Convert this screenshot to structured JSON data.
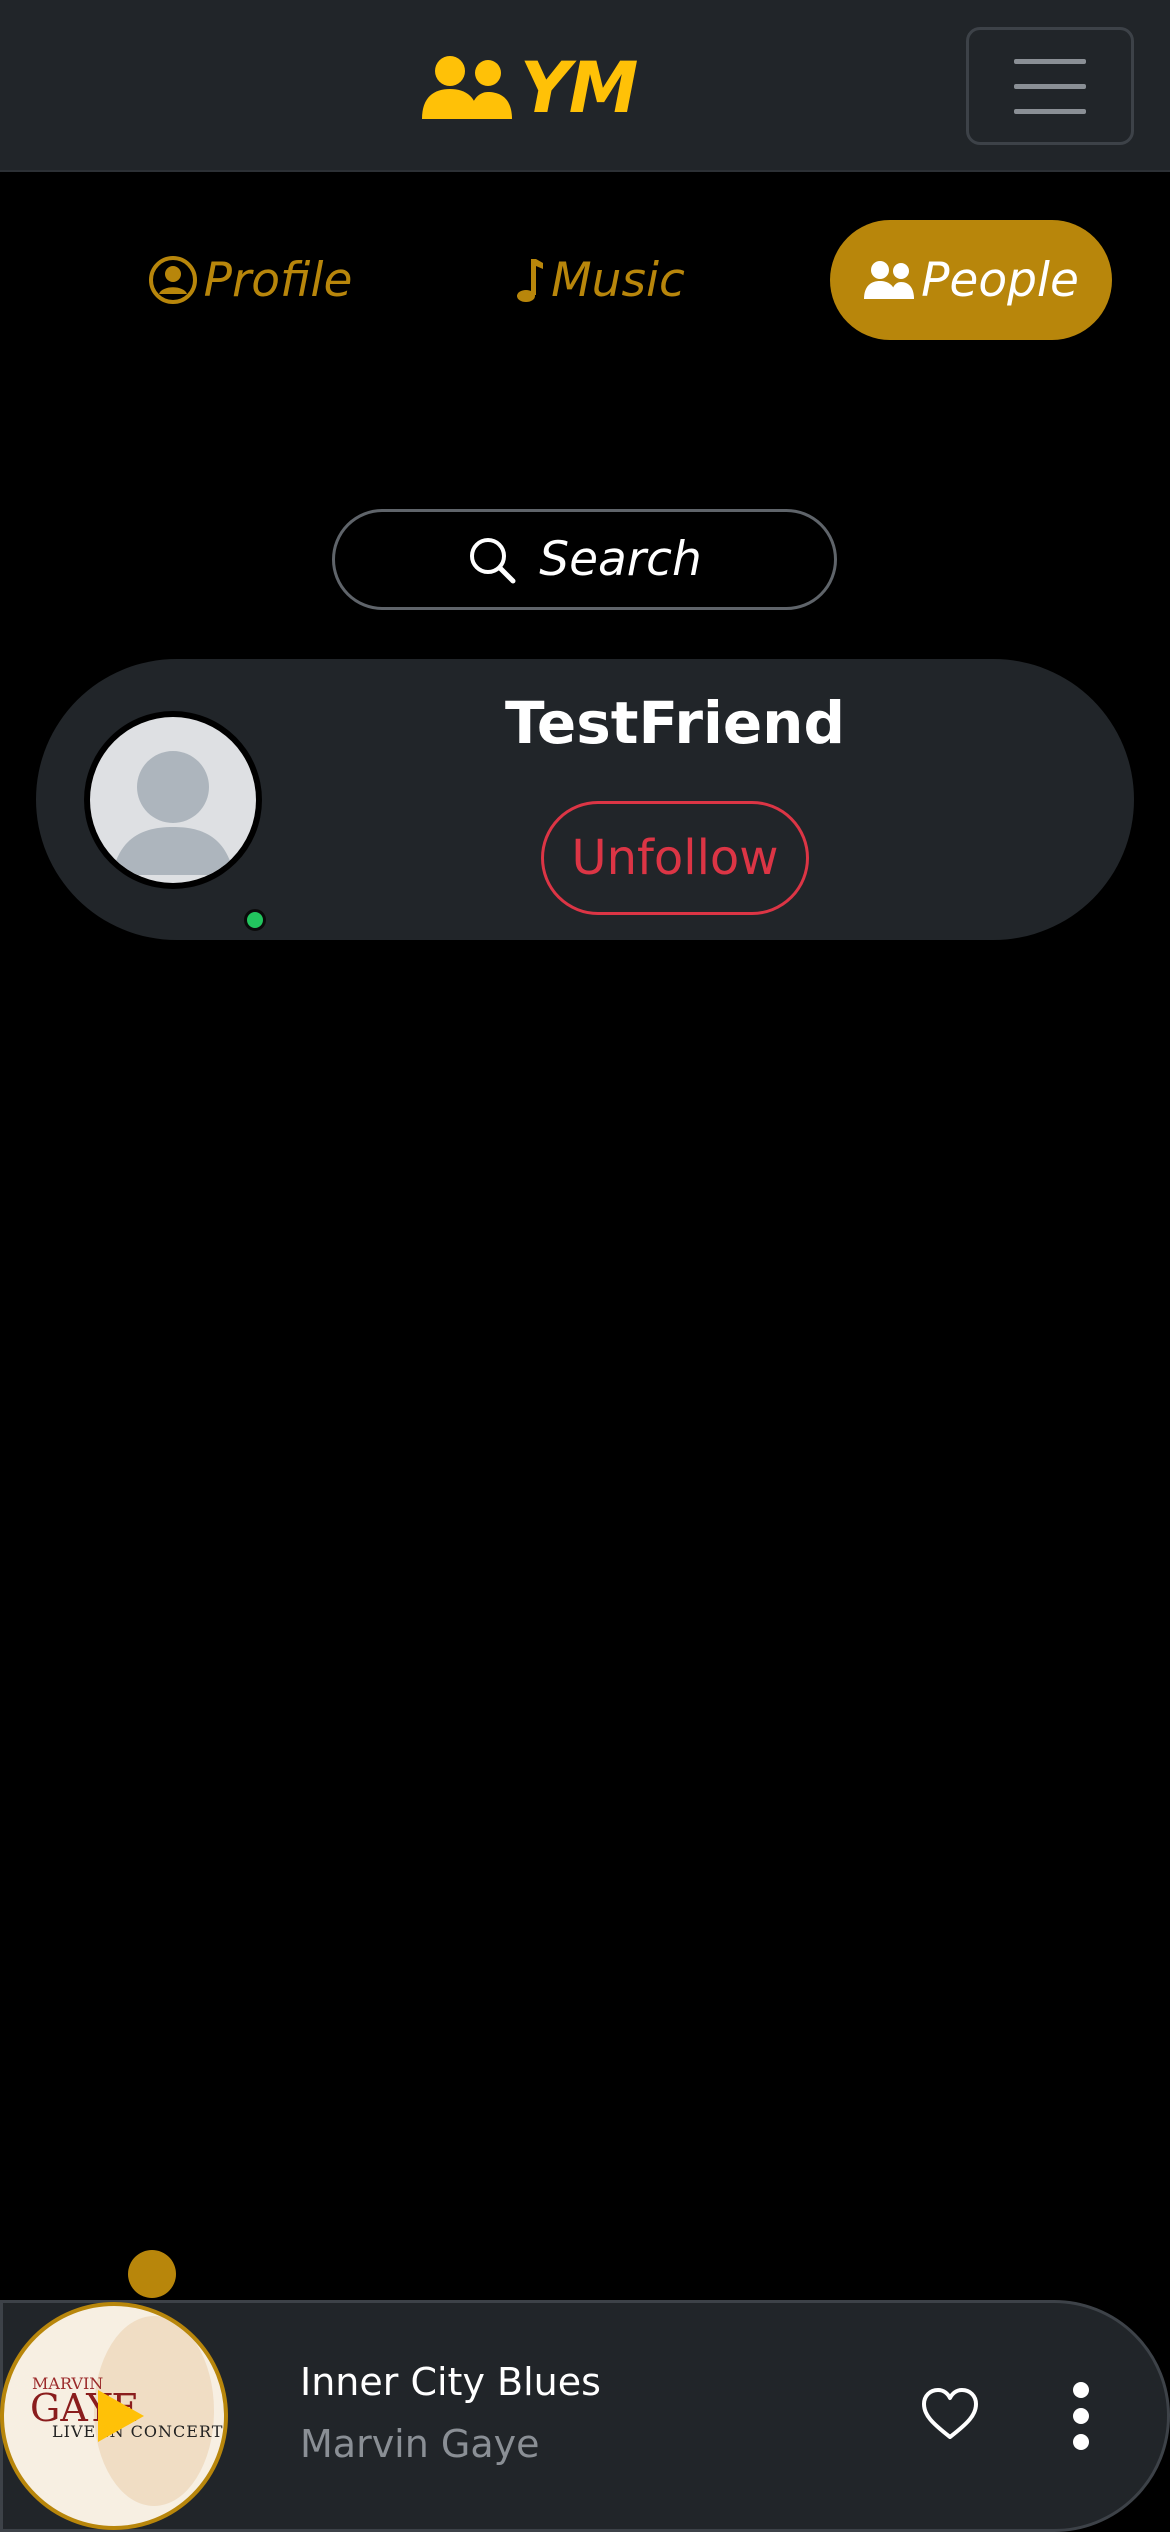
{
  "brand": {
    "text": "YM",
    "accent_color": "#ffc107"
  },
  "tabs": [
    {
      "label": "Profile",
      "icon": "user-circle-icon",
      "active": false
    },
    {
      "label": "Music",
      "icon": "music-note-icon",
      "active": false
    },
    {
      "label": "People",
      "icon": "people-icon",
      "active": true
    }
  ],
  "search": {
    "label": "Search",
    "icon": "search-icon"
  },
  "friends": [
    {
      "name": "TestFriend",
      "action_label": "Unfollow",
      "online": true
    }
  ],
  "player": {
    "title": "Inner City Blues",
    "artist": "Marvin Gaye",
    "album_art_text": [
      "MARVIN",
      "GAYE",
      "LIVE IN CONCERT"
    ],
    "controls": [
      "play-icon",
      "heart-icon",
      "more-vertical-icon"
    ]
  },
  "colors": {
    "navbar_bg": "#212529",
    "gold": "#b8860b",
    "danger": "#dc3545",
    "online": "#22c55e"
  }
}
